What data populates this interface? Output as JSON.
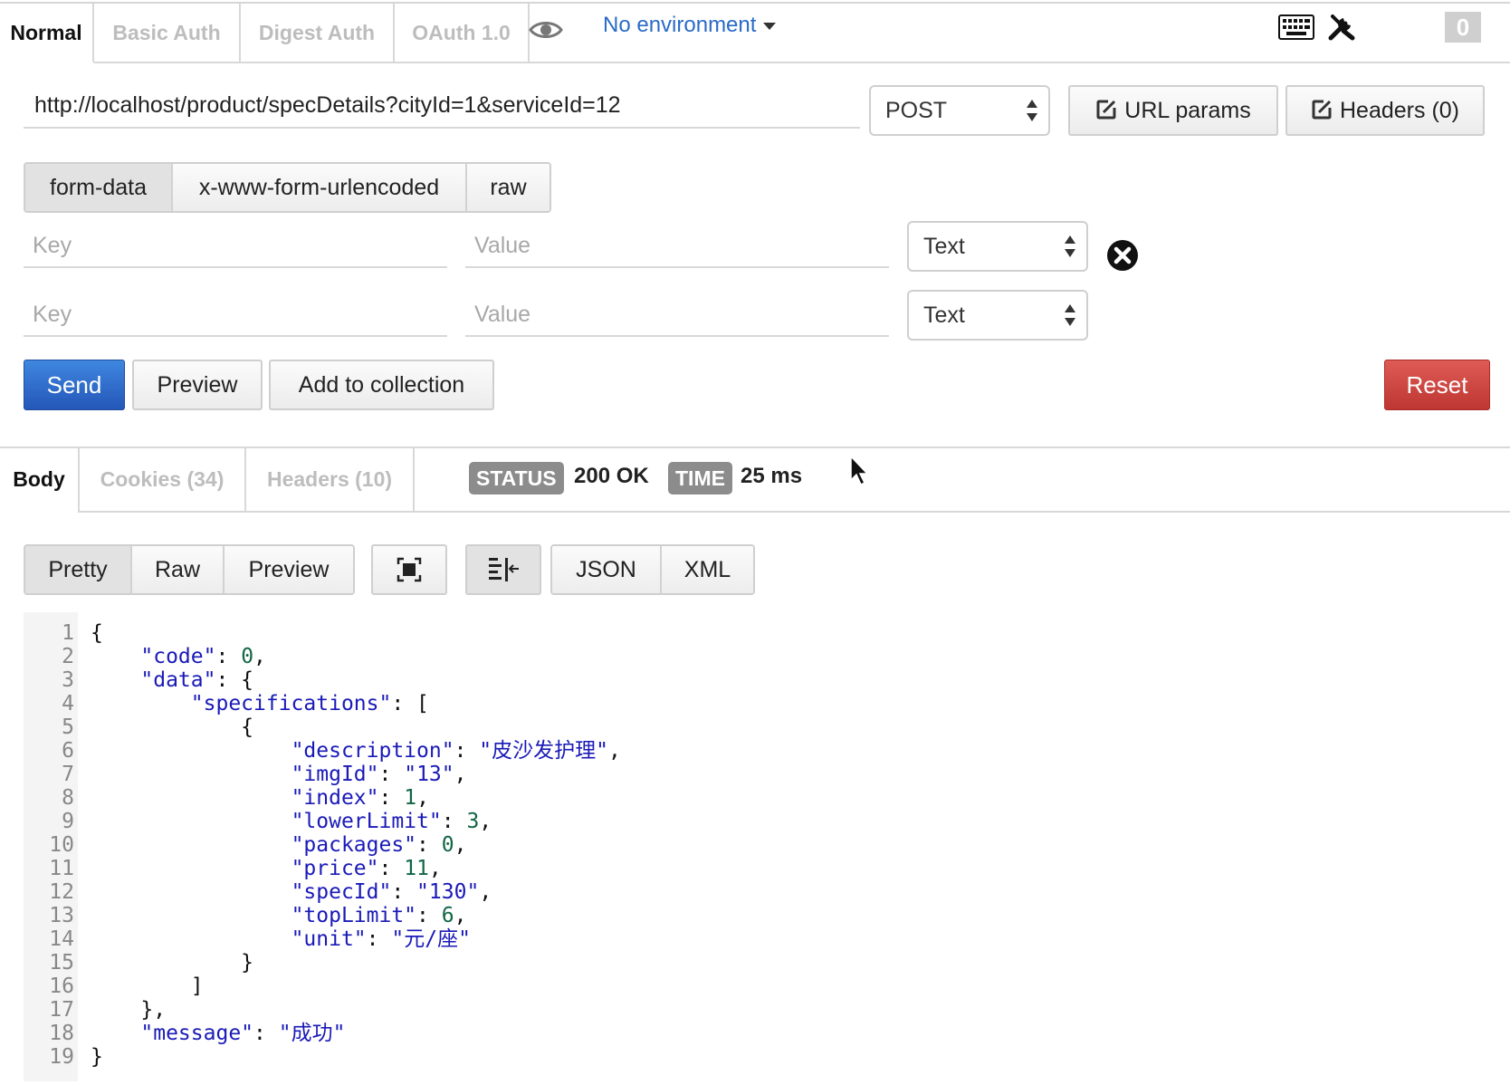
{
  "auth_tabs": [
    {
      "label": "Normal",
      "active": true
    },
    {
      "label": "Basic Auth",
      "active": false
    },
    {
      "label": "Digest Auth",
      "active": false
    },
    {
      "label": "OAuth 1.0",
      "active": false
    }
  ],
  "environment": {
    "label": "No environment"
  },
  "top_right": {
    "counter": "0"
  },
  "request": {
    "url": "http://localhost/product/specDetails?cityId=1&serviceId=12",
    "method": "POST",
    "url_params_label": "URL params",
    "headers_label": "Headers (0)"
  },
  "body_types": [
    {
      "label": "form-data",
      "active": true
    },
    {
      "label": "x-www-form-urlencoded",
      "active": false
    },
    {
      "label": "raw",
      "active": false
    }
  ],
  "form_rows": [
    {
      "key_placeholder": "Key",
      "value_placeholder": "Value",
      "type": "Text"
    },
    {
      "key_placeholder": "Key",
      "value_placeholder": "Value",
      "type": "Text"
    }
  ],
  "actions": {
    "send": "Send",
    "preview": "Preview",
    "add_to_collection": "Add to collection",
    "reset": "Reset"
  },
  "response_tabs": [
    {
      "label": "Body",
      "active": true
    },
    {
      "label": "Cookies (34)",
      "active": false
    },
    {
      "label": "Headers (10)",
      "active": false
    }
  ],
  "status": {
    "label": "STATUS",
    "value": "200 OK"
  },
  "time": {
    "label": "TIME",
    "value": "25 ms"
  },
  "view_modes": [
    {
      "label": "Pretty",
      "active": true
    },
    {
      "label": "Raw",
      "active": false
    },
    {
      "label": "Preview",
      "active": false
    }
  ],
  "formats": [
    {
      "label": "JSON",
      "active": false
    },
    {
      "label": "XML",
      "active": false
    }
  ],
  "response_lines": [
    "1",
    "2",
    "3",
    "4",
    "5",
    "6",
    "7",
    "8",
    "9",
    "10",
    "11",
    "12",
    "13",
    "14",
    "15",
    "16",
    "17",
    "18",
    "19"
  ],
  "response_body": {
    "code": "0",
    "description": "皮沙发护理",
    "imgId": "13",
    "index": "1",
    "lowerLimit": "3",
    "packages": "0",
    "price": "11",
    "specId": "130",
    "topLimit": "6",
    "unit": "元/座",
    "message": "成功"
  },
  "colors": {
    "send": "#2d62c2",
    "reset": "#c9413c",
    "link": "#2a6bc7",
    "json_key": "#1a1ab8",
    "json_number": "#116644"
  }
}
